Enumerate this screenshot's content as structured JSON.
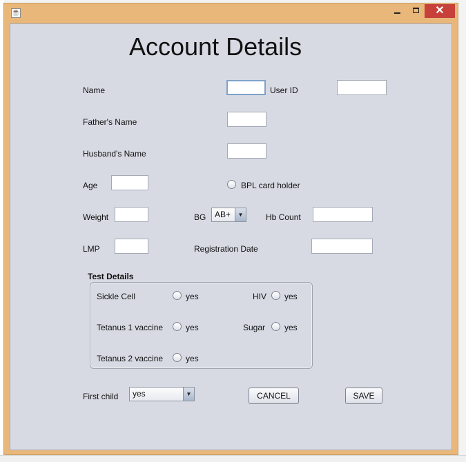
{
  "window": {
    "minimize": "",
    "maximize": "",
    "close": "✕"
  },
  "title": "Account Details",
  "labels": {
    "name": "Name",
    "user_id": "User ID",
    "fathers_name": "Father's Name",
    "husbands_name": "Husband's Name",
    "age": "Age",
    "bpl": "BPL card holder",
    "weight": "Weight",
    "bg": "BG",
    "hb_count": "Hb Count",
    "lmp": "LMP",
    "registration_date": "Registration Date",
    "first_child": "First child"
  },
  "fields": {
    "name": "",
    "user_id": "",
    "fathers_name": "",
    "husbands_name": "",
    "age": "",
    "weight": "",
    "hb_count": "",
    "lmp": "",
    "registration_date": ""
  },
  "bg_select": {
    "selected": "AB+"
  },
  "first_child_select": {
    "selected": "yes"
  },
  "test_details": {
    "title": "Test Details",
    "sickle_cell": "Sickle Cell",
    "hiv": "HIV",
    "tetanus1": "Tetanus 1 vaccine",
    "sugar": "Sugar",
    "tetanus2": "Tetanus 2 vaccine",
    "yes": "yes"
  },
  "buttons": {
    "cancel": "CANCEL",
    "save": "SAVE"
  }
}
